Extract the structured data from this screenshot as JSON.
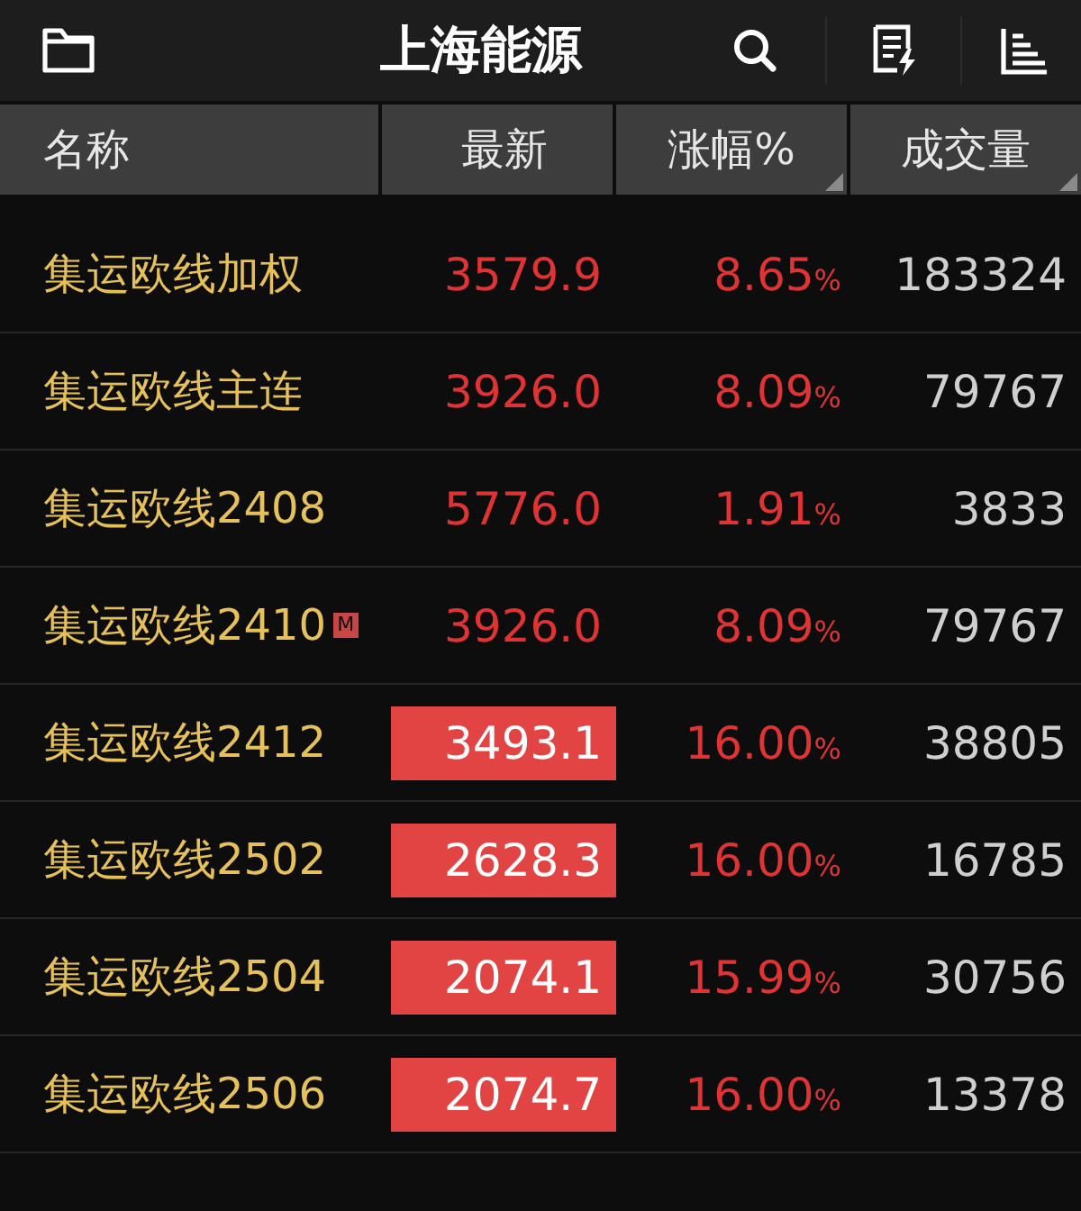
{
  "title": "上海能源",
  "columns": [
    {
      "label": "名称",
      "sort_mark": false
    },
    {
      "label": "最新",
      "sort_mark": false
    },
    {
      "label": "涨幅%",
      "sort_mark": true
    },
    {
      "label": "成交量",
      "sort_mark": true
    }
  ],
  "rows": [
    {
      "name": "集运欧线加权",
      "badge": "",
      "price": "3579.9",
      "limit_up": false,
      "change": "8.65",
      "unit": "%",
      "volume": "183324"
    },
    {
      "name": "集运欧线主连",
      "badge": "",
      "price": "3926.0",
      "limit_up": false,
      "change": "8.09",
      "unit": "%",
      "volume": "79767"
    },
    {
      "name": "集运欧线2408",
      "badge": "",
      "price": "5776.0",
      "limit_up": false,
      "change": "1.91",
      "unit": "%",
      "volume": "3833"
    },
    {
      "name": "集运欧线2410",
      "badge": "M",
      "price": "3926.0",
      "limit_up": false,
      "change": "8.09",
      "unit": "%",
      "volume": "79767"
    },
    {
      "name": "集运欧线2412",
      "badge": "",
      "price": "3493.1",
      "limit_up": true,
      "change": "16.00",
      "unit": "%",
      "volume": "38805"
    },
    {
      "name": "集运欧线2502",
      "badge": "",
      "price": "2628.3",
      "limit_up": true,
      "change": "16.00",
      "unit": "%",
      "volume": "16785"
    },
    {
      "name": "集运欧线2504",
      "badge": "",
      "price": "2074.1",
      "limit_up": true,
      "change": "15.99",
      "unit": "%",
      "volume": "30756"
    },
    {
      "name": "集运欧线2506",
      "badge": "",
      "price": "2074.7",
      "limit_up": true,
      "change": "16.00",
      "unit": "%",
      "volume": "13378"
    }
  ]
}
